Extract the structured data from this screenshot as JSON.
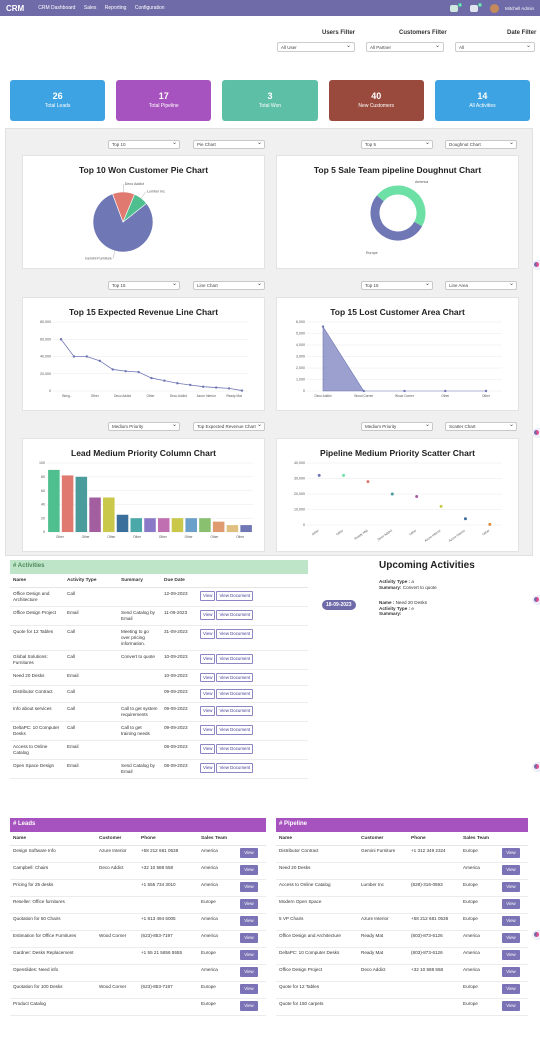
{
  "topbar": {
    "brand": "CRM",
    "nav": [
      "CRM Dashboard",
      "Sales",
      "Reporting",
      "Configuration"
    ],
    "badge1": "4",
    "badge2": "6",
    "user": "Mitchell Admin"
  },
  "filters": {
    "users_label": "Users Filter",
    "customers_label": "Customers Filter",
    "date_label": "Date Filter",
    "users_value": "All User",
    "customers_value": "All Partner",
    "date_value": "All"
  },
  "cards": [
    {
      "num": "26",
      "label": "Total Leads",
      "color": "#3ea3e2"
    },
    {
      "num": "17",
      "label": "Total Pipeline",
      "color": "#a753bf"
    },
    {
      "num": "3",
      "label": "Total Won",
      "color": "#5cbfa6"
    },
    {
      "num": "40",
      "label": "New Customers",
      "color": "#9a4a3d"
    },
    {
      "num": "14",
      "label": "All Activities",
      "color": "#3ea3e2"
    }
  ],
  "selects": {
    "s1": "Top 10",
    "s2": "Pie Chart",
    "s3": "Top 5",
    "s4": "Doughnut Chart",
    "s5": "Top 15",
    "s6": "Line Chart",
    "s7": "Top 15",
    "s8": "Line Area",
    "s9": "Medium Priority",
    "s10": "Top Expected Revenue Chart",
    "s11": "Medium Priority",
    "s12": "Scatter Chart"
  },
  "charts": {
    "pie": {
      "title": "Top 10 Won Customer Pie Chart",
      "labels": [
        "Gemini Furniture",
        "Deco Addict",
        "Lumber Inc"
      ],
      "values": [
        80,
        12,
        8
      ],
      "colors": [
        "#6f77b5",
        "#e07a70",
        "#4fbf8f"
      ]
    },
    "doughnut": {
      "title": "Top 5 Sale Team pipeline Doughnut Chart",
      "labels": [
        "America",
        "Europe"
      ],
      "values": [
        47,
        53
      ],
      "colors": [
        "#6de0a6",
        "#6f77b5"
      ]
    },
    "line": {
      "title": "Top 15 Expected Revenue Line Chart",
      "yticks": [
        "80,000",
        "60,000",
        "40,000",
        "20,000",
        "0"
      ],
      "xlabels": [
        "Bring..",
        "Other",
        "Deco Addict",
        "Other",
        "Deco Addict",
        "Azure Interior",
        "Ready Mat"
      ],
      "values": [
        60000,
        40000,
        40000,
        35000,
        25000,
        23000,
        22000,
        15000,
        12000,
        9000,
        7000,
        5000,
        4000,
        3000,
        500
      ],
      "ymax": 80000
    },
    "area": {
      "title": "Top 15 Lost Customer Area Chart",
      "yticks": [
        "6,000",
        "5,000",
        "4,000",
        "3,000",
        "2,000",
        "1,000",
        "0"
      ],
      "xlabels": [
        "Deco Addict",
        "Wood Corner",
        "Wood Corner",
        "Other",
        "Other"
      ],
      "values": [
        5600,
        0,
        0,
        0,
        0
      ],
      "ymax": 6000
    },
    "column": {
      "title": "Lead Medium Priority Column Chart",
      "yticks": [
        "100",
        "80",
        "60",
        "40",
        "20",
        "0"
      ],
      "xlabels": [
        "Other",
        "Other",
        "Other",
        "Other",
        "Other",
        "Other",
        "Other",
        "Other"
      ],
      "values": [
        90,
        82,
        80,
        50,
        50,
        25,
        20,
        20,
        20,
        20,
        20,
        20,
        15,
        10,
        10
      ],
      "colors": [
        "#4fbf8f",
        "#e07a70",
        "#4a9b9b",
        "#a35ea0",
        "#c9c84b",
        "#3a6f9c",
        "#4aa8a8",
        "#8a79c7",
        "#c070b0",
        "#c9c84b",
        "#6aa0c9",
        "#88c070",
        "#e09a70",
        "#e0c080",
        "#6f77b5"
      ],
      "ymax": 100
    },
    "scatter": {
      "title": "Pipeline Medium Priority Scatter Chart",
      "yticks": [
        "40,000",
        "30,000",
        "20,000",
        "10,000",
        "0"
      ],
      "xlabels": [
        "Other",
        "Other",
        "Ready Mat",
        "Deco Addict",
        "Other",
        "Azure Interior",
        "Azure Interior",
        "Other"
      ],
      "values": [
        40000,
        40000,
        35000,
        25000,
        23000,
        15000,
        5000,
        500
      ],
      "colors": [
        "#6f77b5",
        "#6de0a6",
        "#e07a70",
        "#4a9b9b",
        "#a35ea0",
        "#c9c84b",
        "#3a6f9c",
        "#e08a40"
      ],
      "ymax": 50000
    }
  },
  "activities": {
    "title": "# Activities",
    "headers": [
      "Name",
      "Activity Type",
      "Summary",
      "Due Date"
    ],
    "view_label": "View",
    "doc_label": "View Document",
    "rows": [
      {
        "name": "Office Design and Architecture",
        "type": "Call",
        "summary": "",
        "due": "12-09-2023"
      },
      {
        "name": "Office Design Project",
        "type": "Email",
        "summary": "Send Catalog by Email",
        "due": "11-09-2023"
      },
      {
        "name": "Quote for 12 Tables",
        "type": "Call",
        "summary": "Meeting to go over pricing information.",
        "due": "31-09-2023"
      },
      {
        "name": "Global Solutions: Furnitures",
        "type": "Call",
        "summary": "Convert to quote",
        "due": "10-09-2023"
      },
      {
        "name": "Need 20 Desks",
        "type": "Email",
        "summary": "",
        "due": "10-09-2023"
      },
      {
        "name": "Distributor Contract",
        "type": "Call",
        "summary": "",
        "due": "09-09-2023"
      },
      {
        "name": "Info about services",
        "type": "Call",
        "summary": "Call to get system requirements",
        "due": "09-09-2023"
      },
      {
        "name": "DeltaPC: 10 Computer Desks",
        "type": "Call",
        "summary": "Call to get training needs",
        "due": "09-09-2023"
      },
      {
        "name": "Access to Online Catalog",
        "type": "Email",
        "summary": "",
        "due": "08-09-2023"
      },
      {
        "name": "Open Space Design",
        "type": "Email",
        "summary": "Send Catalog by Email",
        "due": "08-09-2023"
      }
    ]
  },
  "upcoming": {
    "title": "Upcoming Activities",
    "date": "18-09-2023",
    "type_label": "Activity Type :",
    "type_value": "a",
    "summary_label": "Summary:",
    "summary_value": "Convert to quote",
    "name_label": "Name :",
    "name_value": "Need 20 Desks",
    "type2_label": "Activity Type :",
    "type2_value": "e",
    "summary2_label": "Summary:",
    "summary2_value": ""
  },
  "leads": {
    "title": "# Leads",
    "headers": [
      "Name",
      "Customer",
      "Phone",
      "Sales Team"
    ],
    "view_label": "View",
    "rows": [
      {
        "name": "Design Software Info",
        "customer": "Azure Interior",
        "phone": "+58 212 681 0538",
        "team": "America"
      },
      {
        "name": "Campbell: Chairs",
        "customer": "Deco Addict",
        "phone": "+32 10 588 558",
        "team": "America"
      },
      {
        "name": "Pricing for 25 desks",
        "customer": "",
        "phone": "+1 555 734 3010",
        "team": "America"
      },
      {
        "name": "Reseller: Office furnitures",
        "customer": "",
        "phone": "",
        "team": "Europe"
      },
      {
        "name": "Quotation for 50 Chairs",
        "customer": "",
        "phone": "+1 813 494 5005",
        "team": "America"
      },
      {
        "name": "Estimation for Office Furnitures",
        "customer": "Wood Corner",
        "phone": "(623)-853-7197",
        "team": "America"
      },
      {
        "name": "Gardner: Desks Replacement",
        "customer": "",
        "phone": "+1 55 21 5656 5555",
        "team": "Europe"
      },
      {
        "name": "Openslides: Need info",
        "customer": "",
        "phone": "",
        "team": "America"
      },
      {
        "name": "Quotation for 100 Desks",
        "customer": "Wood Corner",
        "phone": "(623)-853-7197",
        "team": "Europe"
      },
      {
        "name": "Product Catalog",
        "customer": "",
        "phone": "",
        "team": "Europe"
      }
    ]
  },
  "pipeline": {
    "title": "# Pipeline",
    "headers": [
      "Name",
      "Customer",
      "Phone",
      "Sales Team"
    ],
    "view_label": "View",
    "rows": [
      {
        "name": "Distributor Contract",
        "customer": "Gemini Furniture",
        "phone": "+1 312 349 2324",
        "team": "Europe"
      },
      {
        "name": "Need 20 Desks",
        "customer": "",
        "phone": "",
        "team": "America"
      },
      {
        "name": "Access to Online Catalog",
        "customer": "Lumber Inc",
        "phone": "(828)-316-0593",
        "team": "Europe"
      },
      {
        "name": "Modern Open Space",
        "customer": "",
        "phone": "",
        "team": "Europe"
      },
      {
        "name": "5 VP Chairs",
        "customer": "Azure Interior",
        "phone": "+58 212 681 0538",
        "team": "Europe"
      },
      {
        "name": "Office Design and Architecture",
        "customer": "Ready Mat",
        "phone": "(803)-873-6126",
        "team": "America"
      },
      {
        "name": "DeltaPC: 10 Computer Desks",
        "customer": "Ready Mat",
        "phone": "(803)-873-6126",
        "team": "America"
      },
      {
        "name": "Office Design Project",
        "customer": "Deco Addict",
        "phone": "+32 10 588 558",
        "team": "America"
      },
      {
        "name": "Quote for 12 Tables",
        "customer": "",
        "phone": "",
        "team": "Europe"
      },
      {
        "name": "Quote for 150 carpets",
        "customer": "",
        "phone": "",
        "team": "Europe"
      }
    ]
  }
}
